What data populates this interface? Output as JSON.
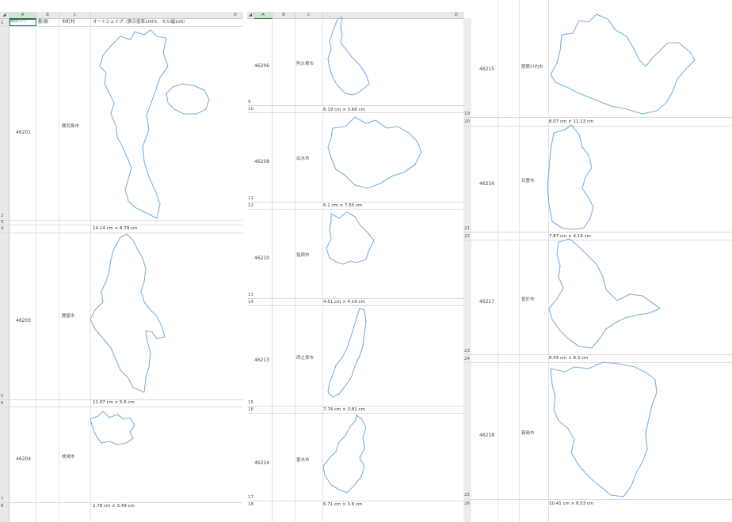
{
  "sheet": {
    "columns": [
      "A",
      "B",
      "C",
      "D"
    ],
    "header_row": {
      "a1_value": "市町村コード",
      "b1": "郡/振",
      "c1": "市町村",
      "d1": "オートシェイプ（表示倍率100%　セル幅100）"
    }
  },
  "panel1": {
    "row_numbers": [
      "1",
      "2",
      "3",
      "4",
      "5",
      "6",
      "7",
      "8"
    ],
    "entries": [
      {
        "code": "46201",
        "name": "鹿児島市",
        "size": "14.14 cm × 8.79 cm"
      },
      {
        "code": "46203",
        "name": "鹿屋市",
        "size": "11.97 cm × 5.6 cm"
      },
      {
        "code": "46204",
        "name": "枕崎市",
        "size": "2.78 cm × 3.49 cm"
      }
    ]
  },
  "panel2": {
    "row_numbers": [
      "9",
      "10",
      "11",
      "12",
      "13",
      "14",
      "15",
      "16",
      "17",
      "18"
    ],
    "entries": [
      {
        "code": "46206",
        "name": "阿久根市",
        "size": "6.19 cm × 3.68 cm"
      },
      {
        "code": "46208",
        "name": "出水市",
        "size": "6.1 cm × 7.55 cm"
      },
      {
        "code": "46210",
        "name": "指宿市",
        "size": "4.51 cm × 4.19 cm"
      },
      {
        "code": "46213",
        "name": "西之表市",
        "size": "7.74 cm × 3.81 cm"
      },
      {
        "code": "46214",
        "name": "垂水市",
        "size": "6.71 cm × 3.6 cm"
      }
    ]
  },
  "panel3": {
    "row_numbers": [
      "19",
      "20",
      "21",
      "22",
      "23",
      "24",
      "25",
      "26"
    ],
    "entries": [
      {
        "code": "46215",
        "name": "薩摩川内市",
        "size": "8.07 cm × 11.13 cm"
      },
      {
        "code": "46216",
        "name": "日置市",
        "size": "7.87 cm × 4.19 cm"
      },
      {
        "code": "46217",
        "name": "曽於市",
        "size": "8.55 cm × 8.3 cm"
      },
      {
        "code": "46218",
        "name": "霧島市",
        "size": "10.41 cm × 8.53 cm"
      }
    ]
  }
}
